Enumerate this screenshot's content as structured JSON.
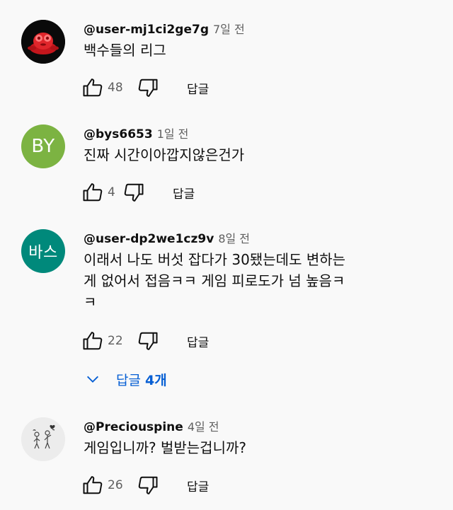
{
  "comments": [
    {
      "author": "@user-mj1ci2ge7g",
      "time": "7일 전",
      "text": "백수들의 리그",
      "likes": "48",
      "reply_label": "답글",
      "avatar": {
        "type": "image",
        "icon": "red-blob-character-avatar",
        "bg": "#0a0a0a"
      }
    },
    {
      "author": "@bys6653",
      "time": "1일 전",
      "text": "진짜 시간이아깝지않은건가",
      "likes": "4",
      "reply_label": "답글",
      "avatar": {
        "type": "initials",
        "initials": "BY",
        "bg": "#7cb342"
      }
    },
    {
      "author": "@user-dp2we1cz9v",
      "time": "8일 전",
      "text": "이래서 나도 버섯 잡다가 30됐는데도 변하는\n게 없어서 접음ㅋㅋ 게임 피로도가 넘 높음ㅋ\nㅋ",
      "likes": "22",
      "reply_label": "답글",
      "avatar": {
        "type": "initials",
        "initials": "바스",
        "bg": "#00897b"
      },
      "replies_toggle": {
        "label": "답글 ",
        "count": "4개",
        "icon": "chevron-down-icon"
      }
    },
    {
      "author": "@Preciouspine",
      "time": "4일 전",
      "text": "게임입니까? 벌받는겁니까?",
      "likes": "26",
      "reply_label": "답글",
      "avatar": {
        "type": "image",
        "icon": "stick-figures-sketch-avatar",
        "bg": "#ececec"
      }
    }
  ],
  "colors": {
    "link": "#065fd4",
    "meta": "#606060",
    "text": "#0f0f0f",
    "background": "#f9f9f9"
  }
}
